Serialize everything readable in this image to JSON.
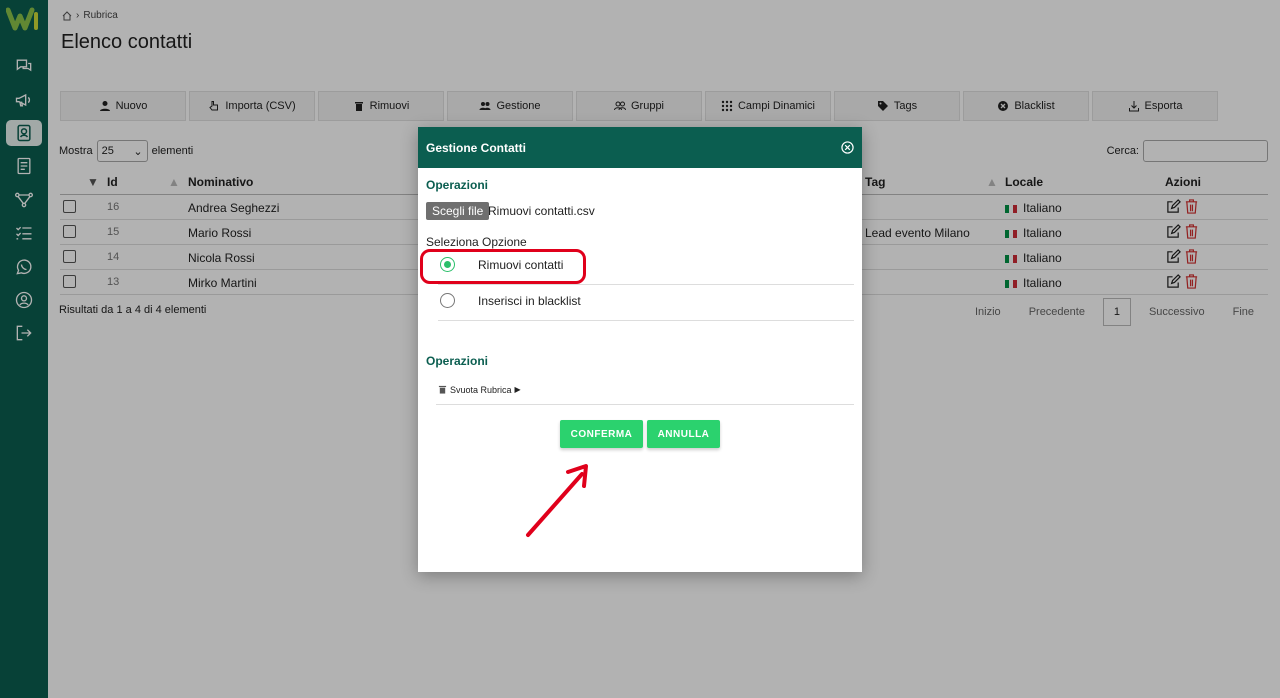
{
  "sidebar": {
    "items": [
      {
        "name": "chat-icon"
      },
      {
        "name": "megaphone-icon"
      },
      {
        "name": "contacts-icon",
        "active": true
      },
      {
        "name": "document-icon"
      },
      {
        "name": "flow-icon"
      },
      {
        "name": "checklist-icon"
      },
      {
        "name": "whatsapp-icon"
      },
      {
        "name": "user-icon"
      },
      {
        "name": "logout-icon"
      }
    ]
  },
  "breadcrumb": {
    "current": "Rubrica"
  },
  "page_title": "Elenco contatti",
  "toolbar": {
    "buttons": [
      {
        "label": "Nuovo",
        "icon": "user-plus-icon"
      },
      {
        "label": "Importa (CSV)",
        "icon": "hand-pointer-icon"
      },
      {
        "label": "Rimuovi",
        "icon": "trash-icon"
      },
      {
        "label": "Gestione",
        "icon": "users-cog-icon"
      },
      {
        "label": "Gruppi",
        "icon": "group-icon"
      },
      {
        "label": "Campi Dinamici",
        "icon": "grid-icon"
      },
      {
        "label": "Tags",
        "icon": "tag-icon"
      },
      {
        "label": "Blacklist",
        "icon": "ban-icon"
      },
      {
        "label": "Esporta",
        "icon": "download-icon"
      }
    ]
  },
  "list": {
    "show_label": "Mostra",
    "show_value": "25",
    "elements_label": "elementi",
    "search_label": "Cerca:",
    "search_value": ""
  },
  "table": {
    "headers": {
      "id": "Id",
      "name": "Nominativo",
      "tag": "Tag",
      "locale": "Locale",
      "actions": "Azioni"
    },
    "rows": [
      {
        "id": "16",
        "name": "Andrea Seghezzi",
        "tag": "",
        "locale": "Italiano"
      },
      {
        "id": "15",
        "name": "Mario Rossi",
        "tag": "Lead evento Milano",
        "locale": "Italiano"
      },
      {
        "id": "14",
        "name": "Nicola Rossi",
        "tag": "",
        "locale": "Italiano"
      },
      {
        "id": "13",
        "name": "Mirko Martini",
        "tag": "",
        "locale": "Italiano"
      }
    ]
  },
  "results_text": "Risultati da 1 a 4 di 4 elementi",
  "pager": {
    "first": "Inizio",
    "prev": "Precedente",
    "page": "1",
    "next": "Successivo",
    "last": "Fine"
  },
  "modal": {
    "title": "Gestione Contatti",
    "section1": "Operazioni",
    "file_button": "Scegli file",
    "file_name": "Rimuovi contatti.csv",
    "option_label": "Seleziona Opzione",
    "options": [
      {
        "label": "Rimuovi contatti",
        "checked": true
      },
      {
        "label": "Inserisci in blacklist",
        "checked": false
      }
    ],
    "section2": "Operazioni",
    "svuota_label": "Svuota Rubrica",
    "confirm": "CONFERMA",
    "cancel": "ANNULLA"
  },
  "colors": {
    "brand": "#0b5e50",
    "accent_green": "#2bd26e",
    "highlight_red": "#e0001b"
  }
}
